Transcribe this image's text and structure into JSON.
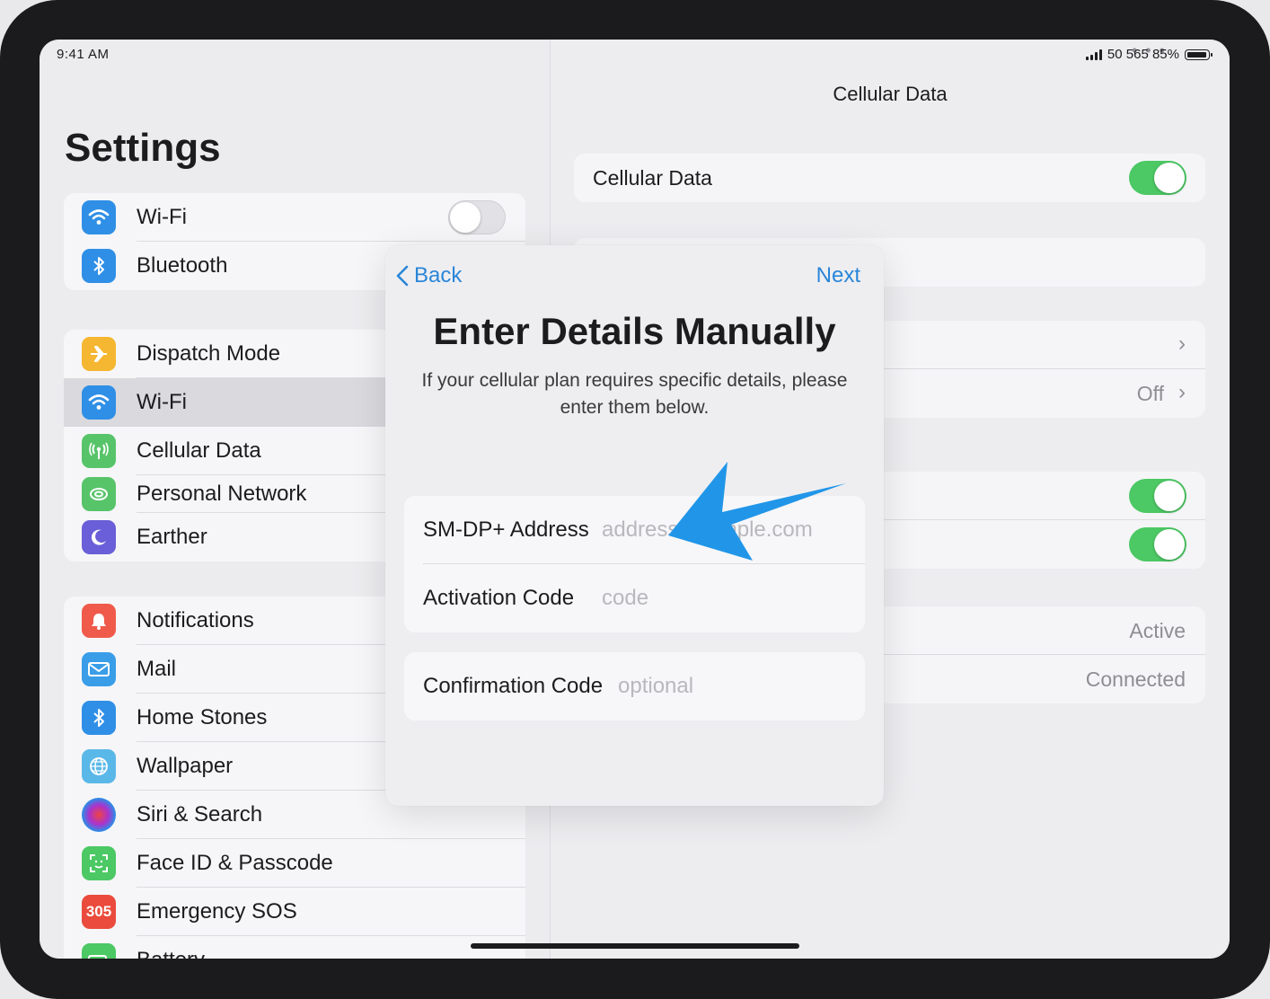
{
  "status": {
    "time": "9:41 AM",
    "center": "• • •",
    "right_text": "50  565  85%"
  },
  "sidebar": {
    "title": "Settings",
    "group1": [
      {
        "label": "Wi-Fi",
        "icon": "wifi-icon",
        "color": "#2f8fe6"
      },
      {
        "label": "Bluetooth",
        "icon": "bluetooth-icon",
        "color": "#2f8fe6"
      }
    ],
    "group2": [
      {
        "label": "Dispatch Mode",
        "icon": "airplane-icon",
        "color": "#f5b731"
      },
      {
        "label": "Wi-Fi",
        "icon": "wifi-icon",
        "color": "#2f8fe6"
      },
      {
        "label": "Cellular Data",
        "icon": "antenna-icon",
        "color": "#58c46a"
      },
      {
        "label": "Personal Network",
        "icon": "hotspot-icon",
        "color": "#58c46a"
      },
      {
        "label": "Earther",
        "icon": "moon-icon",
        "color": "#6a5fd8"
      }
    ],
    "group3": [
      {
        "label": "Notifications",
        "icon": "bell-icon",
        "color": "#f05a4a"
      },
      {
        "label": "Mail",
        "icon": "envelope-icon",
        "color": "#3a9de8"
      },
      {
        "label": "Home Stones",
        "icon": "bluetooth-icon",
        "color": "#2f8fe6"
      },
      {
        "label": "Wallpaper",
        "icon": "globe-icon",
        "color": "#5ab8e8"
      },
      {
        "label": "Siri & Search",
        "icon": "siri-icon",
        "color": "#2b2b6a"
      },
      {
        "label": "Face ID & Passcode",
        "icon": "face-id-icon",
        "color": "#4cc864"
      },
      {
        "label": "Emergency SOS",
        "icon": "sos-icon",
        "icon_text": "305",
        "color": "#ea4b3c"
      },
      {
        "label": "Battery",
        "icon": "battery-icon",
        "color": "#4cc864"
      }
    ]
  },
  "detail": {
    "title": "Cellular Data",
    "cellular_label": "Cellular Data",
    "cellular_on": true,
    "row_off_value": "Off",
    "toggle_a_on": true,
    "toggle_b_on": true,
    "status_value": "Active",
    "connection_value": "Connected"
  },
  "modal": {
    "back": "Back",
    "next": "Next",
    "title": "Enter Details Manually",
    "description": "If your cellular plan requires specific details, please enter them below.",
    "fields": [
      {
        "label": "SM-DP+ Address",
        "placeholder": "address.example.com"
      },
      {
        "label": "Activation Code",
        "placeholder": "code"
      },
      {
        "label": "Confirmation Code",
        "placeholder": "optional"
      }
    ]
  },
  "colors": {
    "accent": "#2a86d8",
    "toggle_on": "#4cc864",
    "arrow": "#2196e8"
  }
}
